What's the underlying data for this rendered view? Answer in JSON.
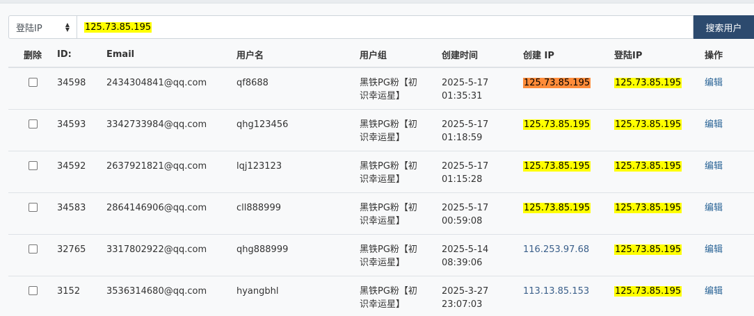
{
  "search": {
    "field_select": "登陆IP",
    "query": "125.73.85.195",
    "button": "搜索用户"
  },
  "columns": {
    "delete": "删除",
    "id": "ID:",
    "email": "Email",
    "username": "用户名",
    "group": "用户组",
    "created_time": "创建时间",
    "created_ip": "创建 IP",
    "login_ip": "登陆IP",
    "action": "操作"
  },
  "rows": [
    {
      "id": "34598",
      "email": "2434304841@qq.com",
      "username": "qf8688",
      "group_1": "黑铁PG粉【初",
      "group_2": "识幸运星】",
      "date": "2025-5-17",
      "time": "01:35:31",
      "created_ip": "125.73.85.195",
      "login_ip": "125.73.85.195",
      "action": "编辑"
    },
    {
      "id": "34593",
      "email": "3342733984@qq.com",
      "username": "qhg123456",
      "group_1": "黑铁PG粉【初",
      "group_2": "识幸运星】",
      "date": "2025-5-17",
      "time": "01:18:59",
      "created_ip": "125.73.85.195",
      "login_ip": "125.73.85.195",
      "action": "编辑"
    },
    {
      "id": "34592",
      "email": "2637921821@qq.com",
      "username": "lqj123123",
      "group_1": "黑铁PG粉【初",
      "group_2": "识幸运星】",
      "date": "2025-5-17",
      "time": "01:15:28",
      "created_ip": "125.73.85.195",
      "login_ip": "125.73.85.195",
      "action": "编辑"
    },
    {
      "id": "34583",
      "email": "2864146906@qq.com",
      "username": "cll888999",
      "group_1": "黑铁PG粉【初",
      "group_2": "识幸运星】",
      "date": "2025-5-17",
      "time": "00:59:08",
      "created_ip": "125.73.85.195",
      "login_ip": "125.73.85.195",
      "action": "编辑"
    },
    {
      "id": "32765",
      "email": "3317802922@qq.com",
      "username": "qhg888999",
      "group_1": "黑铁PG粉【初",
      "group_2": "识幸运星】",
      "date": "2025-5-14",
      "time": "08:39:06",
      "created_ip": "116.253.97.68",
      "login_ip": "125.73.85.195",
      "action": "编辑"
    },
    {
      "id": "3152",
      "email": "3536314680@qq.com",
      "username": "hyangbhl",
      "group_1": "黑铁PG粉【初",
      "group_2": "识幸运星】",
      "date": "2025-3-27",
      "time": "23:07:03",
      "created_ip": "113.13.85.153",
      "login_ip": "125.73.85.195",
      "action": "编辑"
    }
  ],
  "colors": {
    "highlight": "#ffff00",
    "highlight_current": "#ff8c3a",
    "button": "#2c4a6e",
    "link": "#3a5f8a"
  }
}
